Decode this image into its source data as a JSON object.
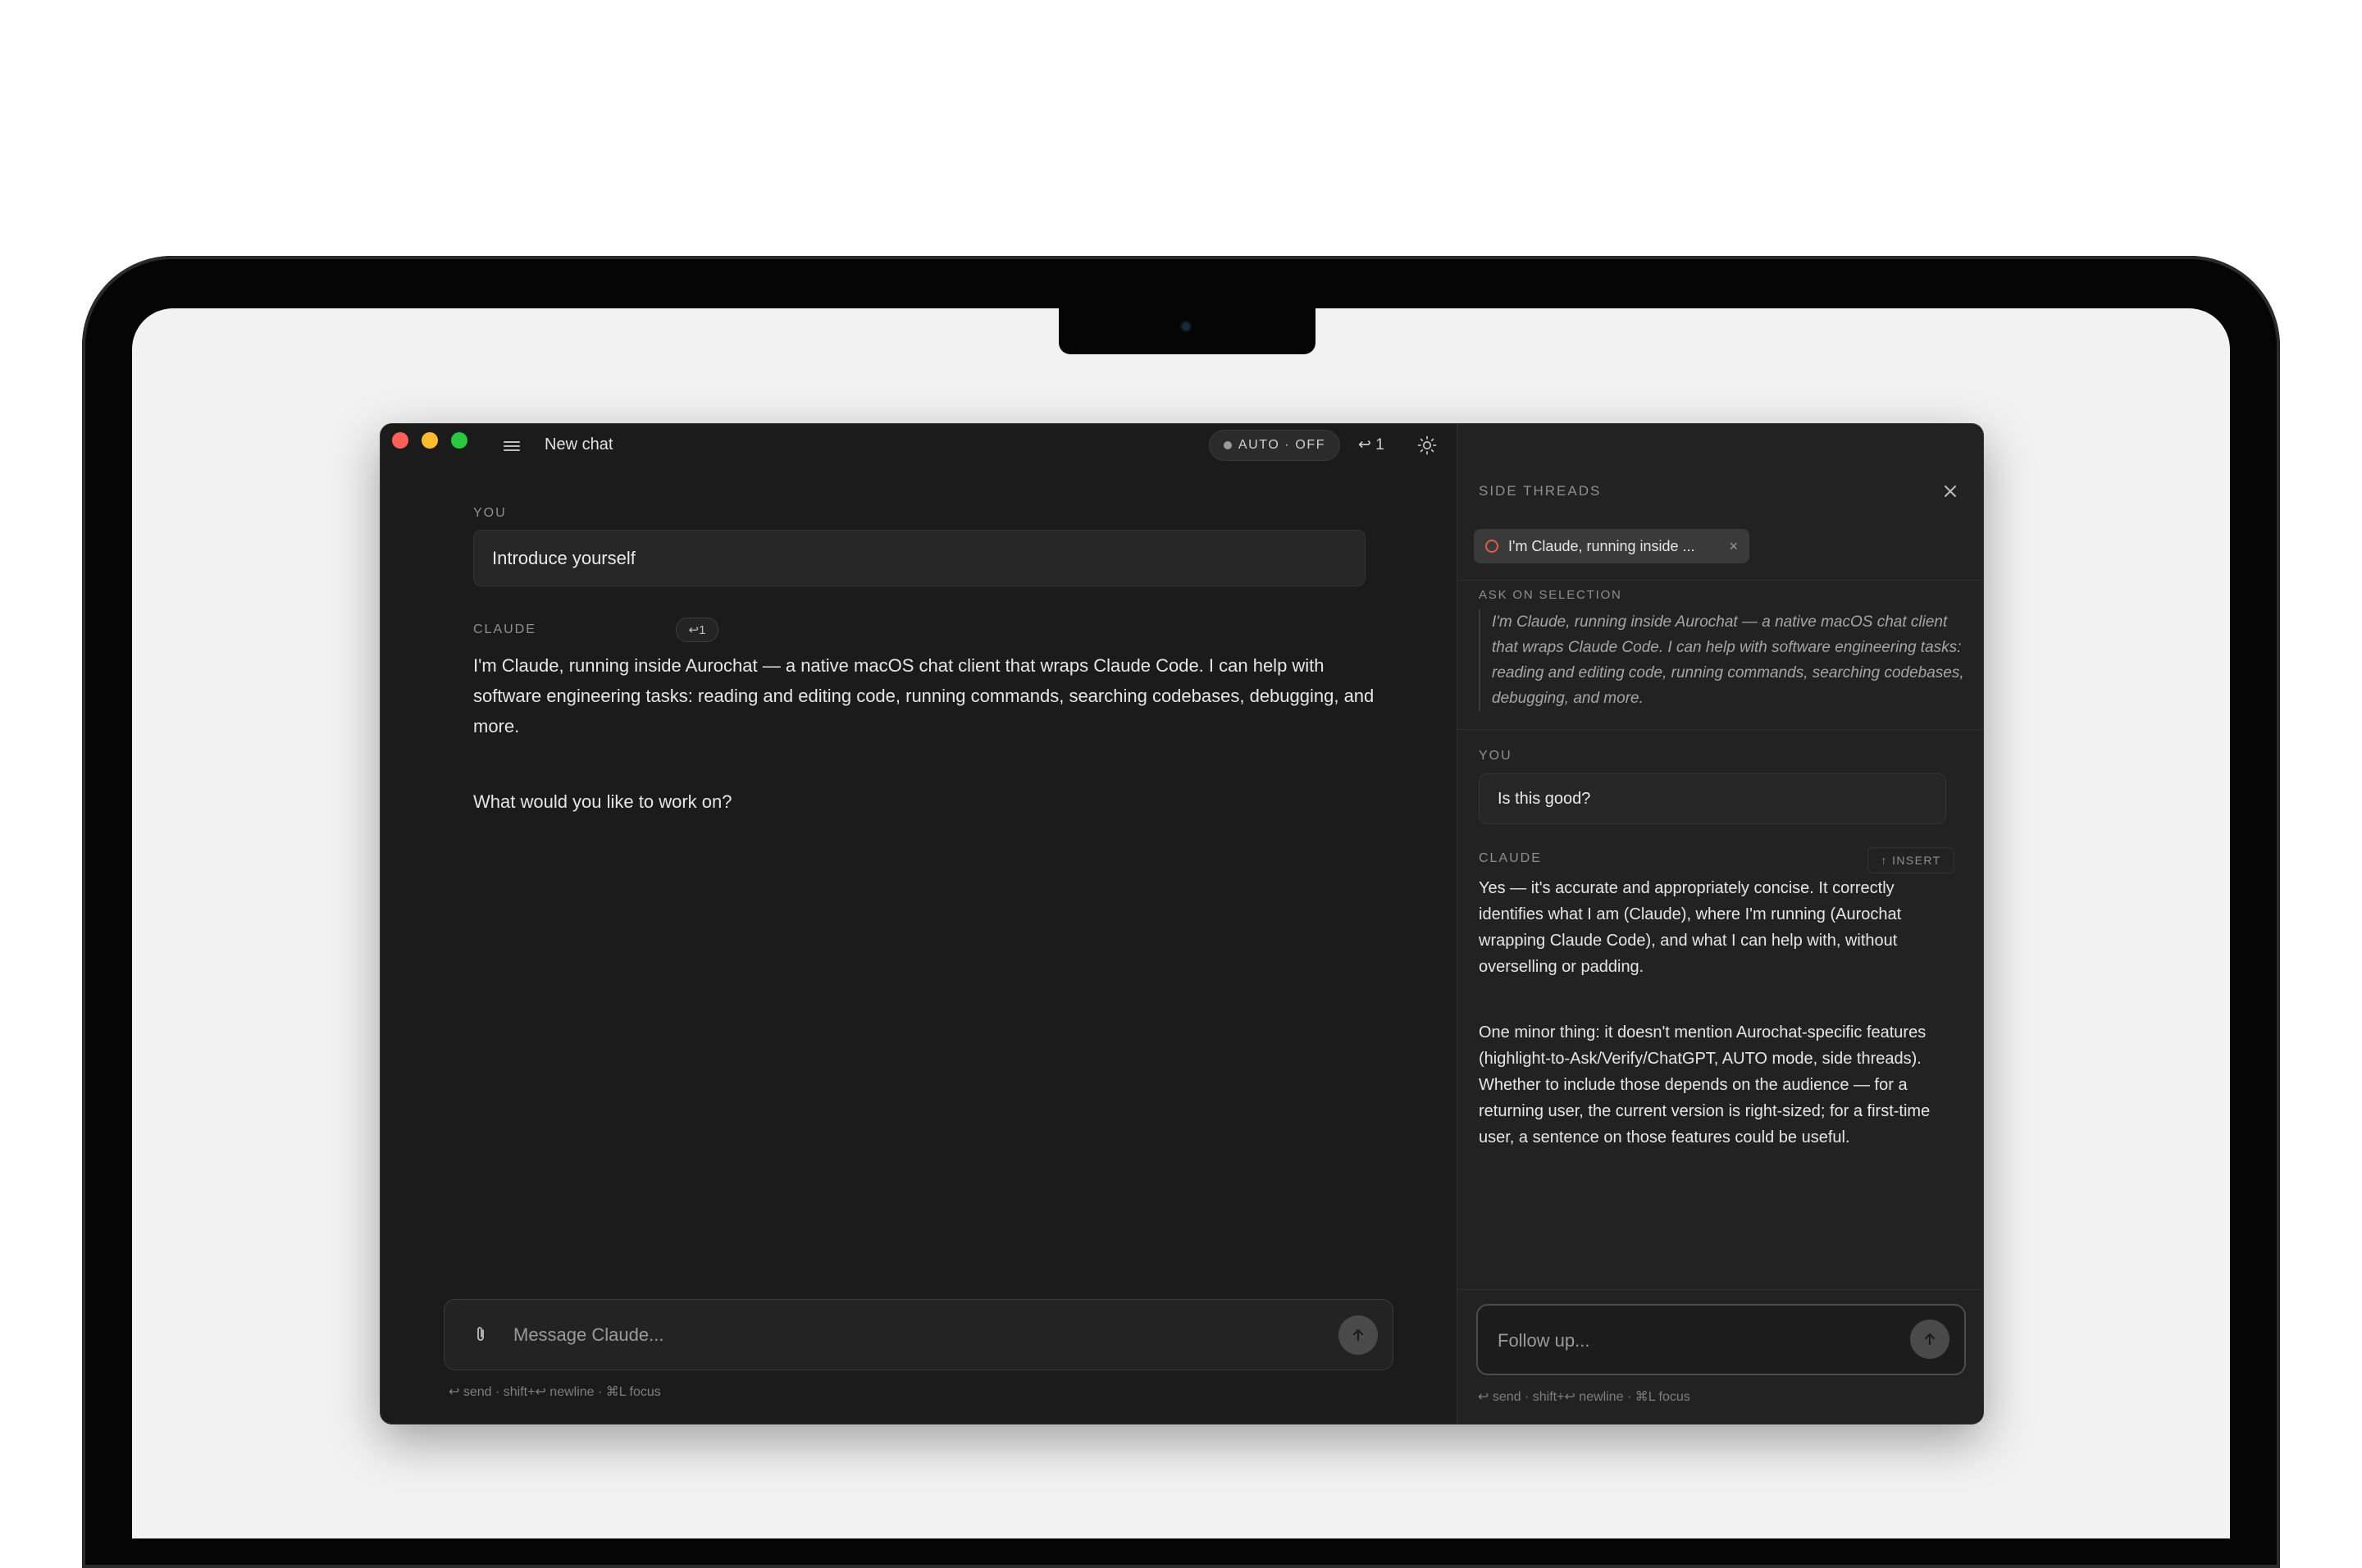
{
  "window": {
    "title": "New chat"
  },
  "toolbar": {
    "auto_label": "AUTO · OFF",
    "return_count": "↩ 1"
  },
  "conversation": {
    "you_label": "YOU",
    "user_message": "Introduce yourself",
    "claude_label": "CLAUDE",
    "turn_badge": "↩1",
    "claude_paragraphs": [
      "I'm Claude, running inside Aurochat — a native macOS chat client that wraps Claude Code. I can help with software engineering tasks: reading and editing code, running commands, searching codebases, debugging, and more.",
      "What would you like to work on?"
    ]
  },
  "composer": {
    "placeholder": "Message Claude...",
    "hint": "↩ send · shift+↩ newline · ⌘L focus"
  },
  "side_threads": {
    "header": "SIDE THREADS",
    "chip_label": "I'm Claude, running inside ...",
    "ask_label": "ASK ON SELECTION",
    "quote": "I'm Claude, running inside Aurochat — a native macOS chat client that wraps Claude Code. I can help with software engineering tasks: reading and editing code, running commands, searching codebases, debugging, and more.",
    "you_label": "YOU",
    "user_message": "Is this good?",
    "claude_label": "CLAUDE",
    "insert_label": "↑ INSERT",
    "claude_paragraphs": [
      "Yes — it's accurate and appropriately concise. It correctly identifies what I am (Claude), where I'm running (Aurochat wrapping Claude Code), and what I can help with, without overselling or padding.",
      "One minor thing: it doesn't mention Aurochat-specific features (highlight-to-Ask/Verify/ChatGPT, AUTO mode, side threads). Whether to include those depends on the audience — for a returning user, the current version is right-sized; for a first-time user, a sentence on those features could be useful."
    ],
    "followup_placeholder": "Follow up...",
    "hint": "↩ send · shift+↩ newline · ⌘L focus"
  },
  "colors": {
    "app_background": "#1b1b1b",
    "side_background": "#222222",
    "close": "#fe5f57",
    "minimize": "#febc2e",
    "zoom": "#28c840"
  },
  "icons": [
    "hamburger-menu-icon",
    "sun-icon",
    "paperclip-icon",
    "arrow-up-icon",
    "close-icon",
    "thread-icon"
  ]
}
